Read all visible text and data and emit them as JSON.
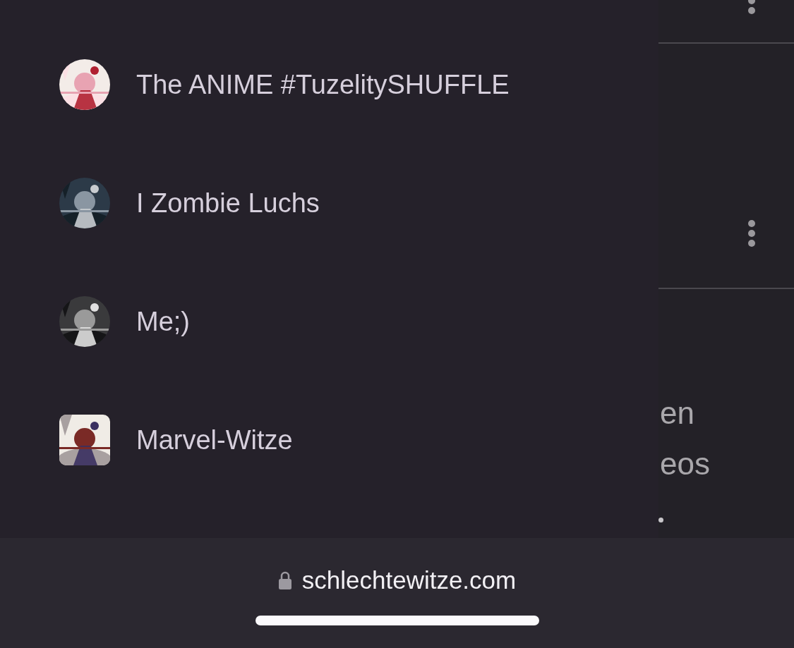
{
  "drawer": {
    "items": [
      {
        "label": "The ANIME #TuzelitySHUFFLE"
      },
      {
        "label": "I Zombie Luchs"
      },
      {
        "label": "Me;)"
      },
      {
        "label": "Marvel-Witze"
      }
    ]
  },
  "background_page": {
    "texts": [
      "en",
      "eos"
    ]
  },
  "browser_bar": {
    "url": "schlechtewitze.com"
  }
}
